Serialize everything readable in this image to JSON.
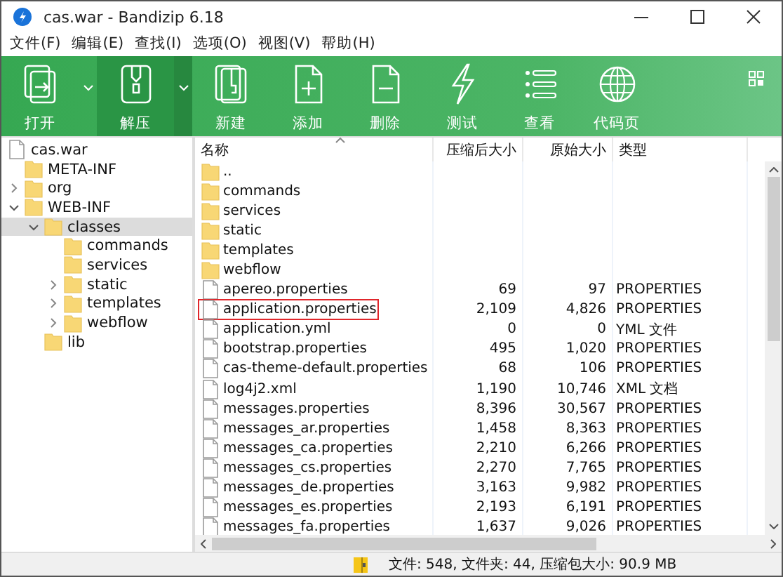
{
  "window": {
    "title": "cas.war - Bandizip 6.18"
  },
  "menu": [
    "文件(F)",
    "编辑(E)",
    "查找(I)",
    "选项(O)",
    "视图(V)",
    "帮助(H)"
  ],
  "toolbar": [
    {
      "label": "打开",
      "kind": "open",
      "dropdown": true,
      "selected": false
    },
    {
      "label": "解压",
      "kind": "extract",
      "dropdown": true,
      "selected": true
    },
    {
      "label": "新建",
      "kind": "new",
      "dropdown": false,
      "selected": false
    },
    {
      "label": "添加",
      "kind": "add",
      "dropdown": false,
      "selected": false
    },
    {
      "label": "删除",
      "kind": "delete",
      "dropdown": false,
      "selected": false
    },
    {
      "label": "测试",
      "kind": "test",
      "dropdown": false,
      "selected": false
    },
    {
      "label": "查看",
      "kind": "view",
      "dropdown": false,
      "selected": false
    },
    {
      "label": "代码页",
      "kind": "codepage",
      "dropdown": false,
      "selected": false
    }
  ],
  "tree": [
    {
      "label": "cas.war",
      "kind": "file",
      "selected": false,
      "children": [
        {
          "label": "META-INF",
          "kind": "folder",
          "selected": false
        },
        {
          "label": "org",
          "kind": "folder",
          "selected": false,
          "expanded": false
        },
        {
          "label": "WEB-INF",
          "kind": "folder",
          "selected": false,
          "expanded": true,
          "children": [
            {
              "label": "classes",
              "kind": "folder",
              "selected": true,
              "expanded": true,
              "children": [
                {
                  "label": "commands",
                  "kind": "folder",
                  "selected": false
                },
                {
                  "label": "services",
                  "kind": "folder",
                  "selected": false
                },
                {
                  "label": "static",
                  "kind": "folder",
                  "selected": false,
                  "expanded": false
                },
                {
                  "label": "templates",
                  "kind": "folder",
                  "selected": false,
                  "expanded": false
                },
                {
                  "label": "webflow",
                  "kind": "folder",
                  "selected": false,
                  "expanded": false
                }
              ]
            },
            {
              "label": "lib",
              "kind": "folder",
              "selected": false
            }
          ]
        }
      ]
    }
  ],
  "table": {
    "columns": [
      "名称",
      "压缩后大小",
      "原始大小",
      "类型"
    ],
    "rows": [
      {
        "name": "..",
        "kind": "folder",
        "marked": false
      },
      {
        "name": "commands",
        "kind": "folder",
        "marked": false
      },
      {
        "name": "services",
        "kind": "folder",
        "marked": false
      },
      {
        "name": "static",
        "kind": "folder",
        "marked": false
      },
      {
        "name": "templates",
        "kind": "folder",
        "marked": false
      },
      {
        "name": "webflow",
        "kind": "folder",
        "marked": false
      },
      {
        "name": "apereo.properties",
        "kind": "file",
        "packed": "69",
        "size": "97",
        "type": "PROPERTIES",
        "marked": false
      },
      {
        "name": "application.properties",
        "kind": "file",
        "packed": "2,109",
        "size": "4,826",
        "type": "PROPERTIES",
        "marked": true
      },
      {
        "name": "application.yml",
        "kind": "file",
        "packed": "0",
        "size": "0",
        "type": "YML 文件",
        "marked": false
      },
      {
        "name": "bootstrap.properties",
        "kind": "file",
        "packed": "495",
        "size": "1,020",
        "type": "PROPERTIES",
        "marked": false
      },
      {
        "name": "cas-theme-default.properties",
        "kind": "file",
        "packed": "68",
        "size": "106",
        "type": "PROPERTIES",
        "marked": false
      },
      {
        "name": "log4j2.xml",
        "kind": "file",
        "packed": "1,190",
        "size": "10,746",
        "type": "XML 文档",
        "marked": false
      },
      {
        "name": "messages.properties",
        "kind": "file",
        "packed": "8,396",
        "size": "30,567",
        "type": "PROPERTIES",
        "marked": false
      },
      {
        "name": "messages_ar.properties",
        "kind": "file",
        "packed": "1,458",
        "size": "8,363",
        "type": "PROPERTIES",
        "marked": false
      },
      {
        "name": "messages_ca.properties",
        "kind": "file",
        "packed": "2,210",
        "size": "6,266",
        "type": "PROPERTIES",
        "marked": false
      },
      {
        "name": "messages_cs.properties",
        "kind": "file",
        "packed": "2,270",
        "size": "7,765",
        "type": "PROPERTIES",
        "marked": false
      },
      {
        "name": "messages_de.properties",
        "kind": "file",
        "packed": "3,163",
        "size": "9,982",
        "type": "PROPERTIES",
        "marked": false
      },
      {
        "name": "messages_es.properties",
        "kind": "file",
        "packed": "2,193",
        "size": "6,191",
        "type": "PROPERTIES",
        "marked": false
      },
      {
        "name": "messages_fa.properties",
        "kind": "file",
        "packed": "1,637",
        "size": "9,026",
        "type": "PROPERTIES",
        "marked": false
      }
    ]
  },
  "status_bar": "文件: 548, 文件夹: 44, 压缩包大小: 90.9 MB"
}
